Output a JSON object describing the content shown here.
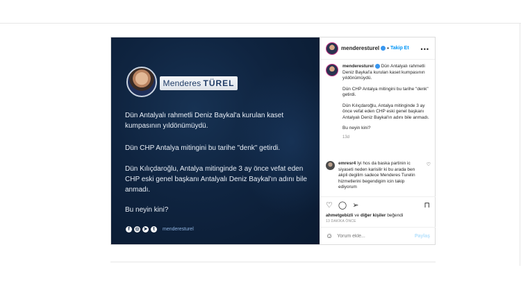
{
  "post_image": {
    "name_first": "Menderes",
    "name_last": "TÜREL",
    "para1": "Dün Antalyalı rahmetli Deniz Baykal'a kurulan kaset kumpasının yıldönümüydü.",
    "para2": "Dün CHP Antalya mitingini bu tarihe \"denk\" getirdi.",
    "para3": "Dün Kılıçdaroğlu, Antalya mitinginde 3 ay önce vefat eden CHP eski genel başkanı Antalyalı Deniz Baykal'ın adını bile anmadı.",
    "para4": "Bu neyin kini?",
    "social_handle": "menderesturel",
    "social_icons": [
      "facebook-icon",
      "instagram-icon",
      "telegram-icon",
      "twitter-icon"
    ]
  },
  "header": {
    "username": "menderesturel",
    "follow_label": "Takip Et",
    "separator": "•",
    "more_glyph": "•••"
  },
  "caption": {
    "username": "menderesturel",
    "line1": "Dün Antalyalı rahmetli Deniz Baykal'a kurulan kaset kumpasının yıldönümüydü.",
    "line2": "Dün CHP Antalya mitingini bu tarihe \"denk\" getirdi.",
    "line3": "Dün Kılıçdaroğlu, Antalya mitinginde 3 ay önce vefat eden CHP eski genel başkanı Antalyalı Deniz Baykal'ın adını bile anmadı.",
    "line4": "Bu neyin kini?",
    "time": "13d"
  },
  "comment": {
    "username": "emresr4",
    "text": "Iyi hos da baska partinin ic siyaseti neden karisilir ki bu arada ben akpli degilim sadece Menderes Turelin hizmetlerini begendigim icin takip ediyorum"
  },
  "likes": {
    "first_user": "ahmetgebizli",
    "connector": "ve",
    "others": "diğer kişiler",
    "suffix": "beğendi",
    "time_ago": "13 DAKİKA ÖNCE"
  },
  "add_comment": {
    "placeholder": "Yorum ekle...",
    "share_label": "Paylaş"
  },
  "colors": {
    "post_bg": "#0f2440",
    "link_blue": "#0095f6",
    "verified_blue": "#3897f0"
  }
}
